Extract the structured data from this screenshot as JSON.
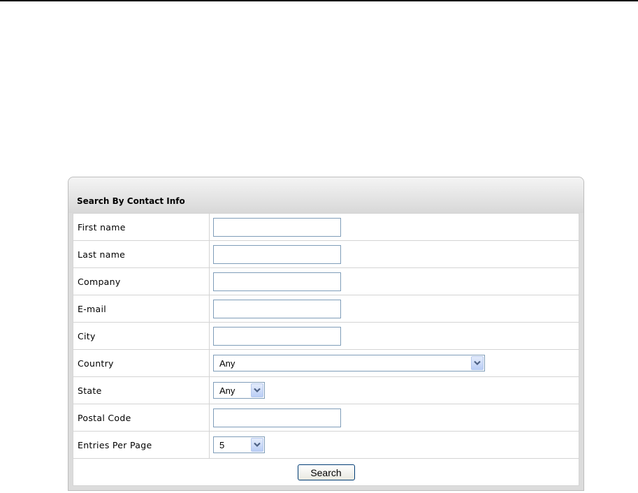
{
  "panel": {
    "title": "Search By Contact Info"
  },
  "fields": {
    "first_name": {
      "label": "First name",
      "value": "",
      "placeholder": ""
    },
    "last_name": {
      "label": "Last name",
      "value": "",
      "placeholder": ""
    },
    "company": {
      "label": "Company",
      "value": "",
      "placeholder": ""
    },
    "email": {
      "label": "E-mail",
      "value": "",
      "placeholder": ""
    },
    "city": {
      "label": "City",
      "value": "",
      "placeholder": ""
    },
    "country": {
      "label": "Country",
      "selected": "Any"
    },
    "state": {
      "label": "State",
      "selected": "Any"
    },
    "postal_code": {
      "label": "Postal Code",
      "value": "",
      "placeholder": ""
    },
    "entries_per_page": {
      "label": "Entries Per Page",
      "selected": "5"
    }
  },
  "actions": {
    "search_label": "Search"
  },
  "icons": {
    "dropdown": "chevron-down-icon"
  },
  "colors": {
    "input_border": "#7f9db9",
    "dropdown_arrow": "#4d6185",
    "button_border": "#003c74",
    "panel_background": "#dcdcdc"
  }
}
